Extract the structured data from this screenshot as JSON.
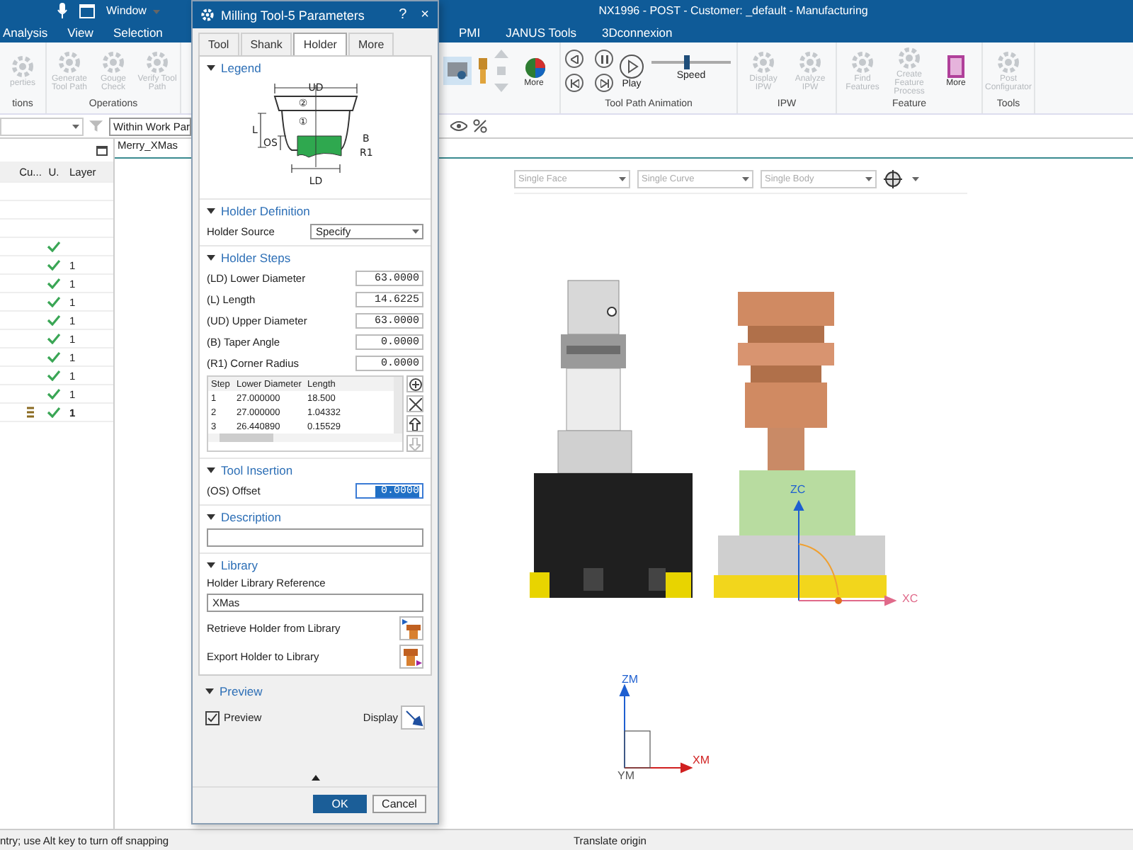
{
  "title_bar": {
    "window_menu": "Window",
    "title": "NX1996 - POST - Customer: _default - Manufacturing"
  },
  "menu_left": [
    {
      "label": "Analysis"
    },
    {
      "label": "View"
    },
    {
      "label": "Selection"
    }
  ],
  "menu_right": [
    {
      "label": "PMI"
    },
    {
      "label": "JANUS Tools"
    },
    {
      "label": "3Dconnexion"
    }
  ],
  "ribbon_left": [
    {
      "label": "tions",
      "items": [
        {
          "label": "perties",
          "disabled": true
        }
      ]
    },
    {
      "label": "Operations",
      "items": [
        {
          "label": "Generate Tool Path",
          "disabled": true
        },
        {
          "label": "Gouge Check",
          "disabled": true
        },
        {
          "label": "Verify Tool Path",
          "disabled": true
        }
      ]
    }
  ],
  "ribbon_view": {
    "more": "More"
  },
  "animation": {
    "label": "Tool Path Animation",
    "play": "Play",
    "speed": {
      "label": "Speed",
      "level": 0.45
    }
  },
  "ribbon_right": [
    {
      "label": "IPW",
      "items": [
        {
          "label": "Display IPW",
          "disabled": true
        },
        {
          "label": "Analyze IPW",
          "disabled": true
        }
      ]
    },
    {
      "label": "Feature",
      "items": [
        {
          "label": "Find Features",
          "disabled": true
        },
        {
          "label": "Create Feature Process",
          "disabled": true
        },
        {
          "label": "More",
          "disabled": false
        }
      ]
    },
    {
      "label": "Tools",
      "items": [
        {
          "label": "Post Configurator",
          "disabled": true
        }
      ]
    }
  ],
  "filter_bar": {
    "scope": "Within Work Par"
  },
  "navigator": {
    "columns": [
      "Cu...",
      "U.",
      "Layer"
    ],
    "rows": [
      {
        "visible": true,
        "current": false
      },
      {
        "visible": true,
        "layer": "1",
        "current": false
      },
      {
        "visible": true,
        "layer": "1",
        "current": false
      },
      {
        "visible": true,
        "layer": "1",
        "current": false
      },
      {
        "visible": true,
        "layer": "1",
        "current": false
      },
      {
        "visible": true,
        "layer": "1",
        "current": false
      },
      {
        "visible": true,
        "layer": "1",
        "current": false
      },
      {
        "visible": true,
        "layer": "1",
        "current": false
      },
      {
        "visible": true,
        "layer": "1",
        "current": false
      },
      {
        "visible": true,
        "layer": "1",
        "current": true
      }
    ]
  },
  "graphics": {
    "tab": "Merry_XMas",
    "selection_filters": [
      "Single Face",
      "Single Curve",
      "Single Body"
    ],
    "labels": {
      "zc": "ZC",
      "xc": "XC",
      "zm": "ZM",
      "xm": "XM",
      "ym": "YM"
    }
  },
  "dialog": {
    "title": "Milling Tool-5 Parameters",
    "help": "?",
    "close": "×",
    "tabs": [
      {
        "label": "Tool",
        "selected": false
      },
      {
        "label": "Shank",
        "selected": false
      },
      {
        "label": "Holder",
        "selected": true
      },
      {
        "label": "More",
        "selected": false
      }
    ],
    "legend": {
      "title": "Legend",
      "expanded": true,
      "labels": {
        "ud": "UD",
        "step_2": "②",
        "step_1": "①",
        "l": "L",
        "os": "OS",
        "b": "B",
        "r1": "R1",
        "ld": "LD"
      }
    },
    "definition": {
      "title": "Holder Definition",
      "expanded": true,
      "source_label": "Holder Source",
      "source_value": "Specify"
    },
    "steps": {
      "title": "Holder Steps",
      "expanded": true,
      "params": [
        {
          "label": "(LD) Lower Diameter",
          "value": "63.0000"
        },
        {
          "label": "(L) Length",
          "value": "14.6225"
        },
        {
          "label": "(UD) Upper Diameter",
          "value": "63.0000"
        },
        {
          "label": "(B) Taper Angle",
          "value": "0.0000"
        },
        {
          "label": "(R1) Corner Radius",
          "value": "0.0000"
        }
      ],
      "columns": [
        "Step",
        "Lower Diameter",
        "Length"
      ],
      "rows": [
        [
          "1",
          "27.000000",
          "18.500"
        ],
        [
          "2",
          "27.000000",
          "1.04332"
        ],
        [
          "3",
          "26.440890",
          "0.15529"
        ]
      ]
    },
    "insertion": {
      "title": "Tool Insertion",
      "expanded": true,
      "label": "(OS) Offset",
      "value": "0.0000",
      "text_selected": true
    },
    "description": {
      "title": "Description",
      "expanded": true
    },
    "library": {
      "title": "Library",
      "expanded": true,
      "reference_label": "Holder Library Reference",
      "reference_value": "XMas",
      "retrieve": "Retrieve Holder from Library",
      "export": "Export Holder to Library"
    },
    "preview": {
      "title": "Preview",
      "expanded": true,
      "checkbox": "Preview",
      "checked": true,
      "display": "Display"
    },
    "ok": "OK",
    "cancel": "Cancel"
  },
  "status_bar": {
    "prompt": "ntry; use Alt key to turn off snapping",
    "message": "Translate origin"
  }
}
